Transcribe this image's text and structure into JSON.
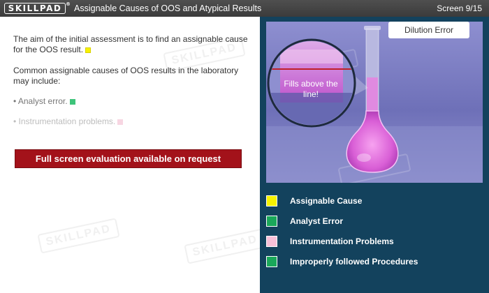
{
  "header": {
    "logo_text": "SKILLPAD",
    "logo_mark": "®",
    "title": "Assignable Causes of OOS and Atypical Results",
    "screen_counter": "Screen 9/15"
  },
  "content": {
    "intro_text": "The aim of the initial assessment is to find an assignable cause for the OOS result.",
    "common_causes_text": "Common assignable causes of OOS results in the laboratory may include:",
    "bullets": [
      {
        "label": "• Analyst error.",
        "color": "#3ec47a"
      },
      {
        "label": "• Instrumentation problems.",
        "color": "#f7c8d8"
      }
    ],
    "intro_chip_color": "#f7f200",
    "eval_button_label": "Full screen evaluation available on request",
    "watermark_text": "SKILLPAD"
  },
  "image_panel": {
    "label": "Dilution Error",
    "callout_text": "Fills above the line!",
    "icon": "volumetric-flask-illustration"
  },
  "legend": [
    {
      "label": "Assignable Cause",
      "color": "#f7f200"
    },
    {
      "label": "Analyst Error",
      "color": "#1aa85a"
    },
    {
      "label": "Instrumentation Problems",
      "color": "#f7c0d8"
    },
    {
      "label": "Improperly followed Procedures",
      "color": "#1aa85a"
    }
  ]
}
